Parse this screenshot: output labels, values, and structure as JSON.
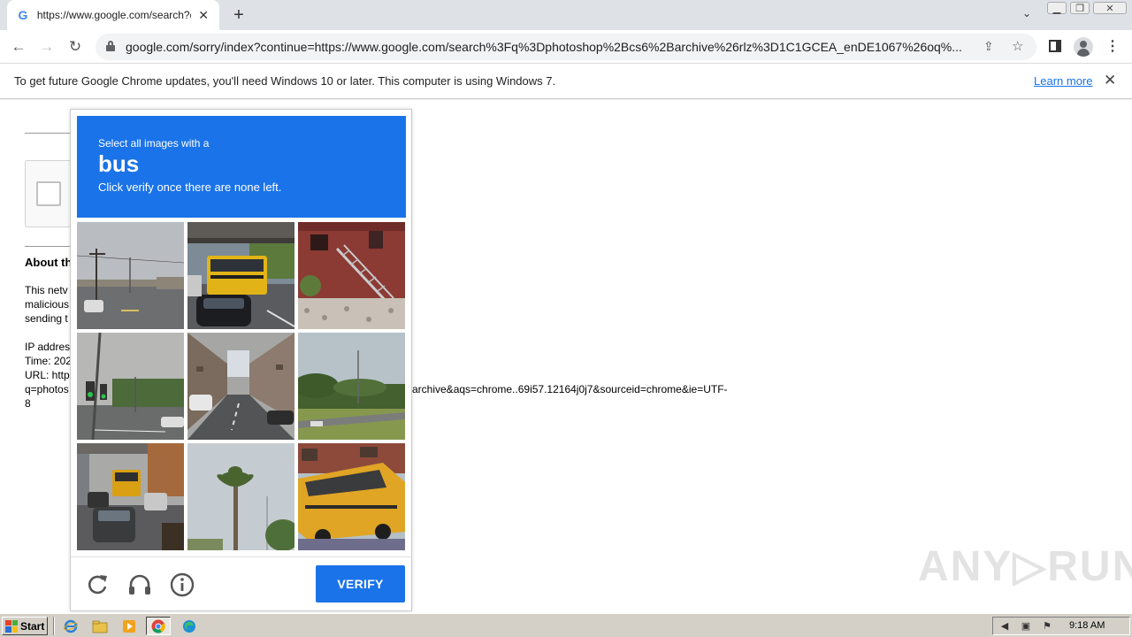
{
  "browser": {
    "tab_title": "https://www.google.com/search?q=",
    "tab_favicon": "G",
    "url": "google.com/sorry/index?continue=https://www.google.com/search%3Fq%3Dphotoshop%2Bcs6%2Barchive%26rlz%3D1C1GCEA_enDE1067%26oq%..."
  },
  "infobar": {
    "message": "To get future Google Chrome updates, you'll need Windows 10 or later. This computer is using Windows 7.",
    "learn_more": "Learn more"
  },
  "background_page": {
    "about_heading": "About th",
    "para_lines": [
      "This netv",
      "malicious",
      "sending t"
    ],
    "ip_line": "IP addres",
    "time_line": "Time: 202",
    "url_line": "URL: http",
    "q_line": "q=photos",
    "last_line": "8",
    "url_tail": "archive&aqs=chrome..69i57.12164j0j7&sourceid=chrome&ie=UTF-"
  },
  "captcha": {
    "instruction_line1": "Select all images with a",
    "target_object": "bus",
    "instruction_line3": "Click verify once there are none left.",
    "verify_label": "VERIFY",
    "accent_color": "#1a73e8",
    "tiles": [
      {
        "scene": "street-poles"
      },
      {
        "scene": "bus-under-bridge"
      },
      {
        "scene": "red-building-stairs"
      },
      {
        "scene": "traffic-light-intersection"
      },
      {
        "scene": "city-street-cars"
      },
      {
        "scene": "green-field-road"
      },
      {
        "scene": "bus-in-traffic"
      },
      {
        "scene": "palm-tree"
      },
      {
        "scene": "school-bus-parked"
      }
    ]
  },
  "watermark": "ANY▷RUN",
  "taskbar": {
    "start_label": "Start",
    "clock": "9:18 AM"
  }
}
